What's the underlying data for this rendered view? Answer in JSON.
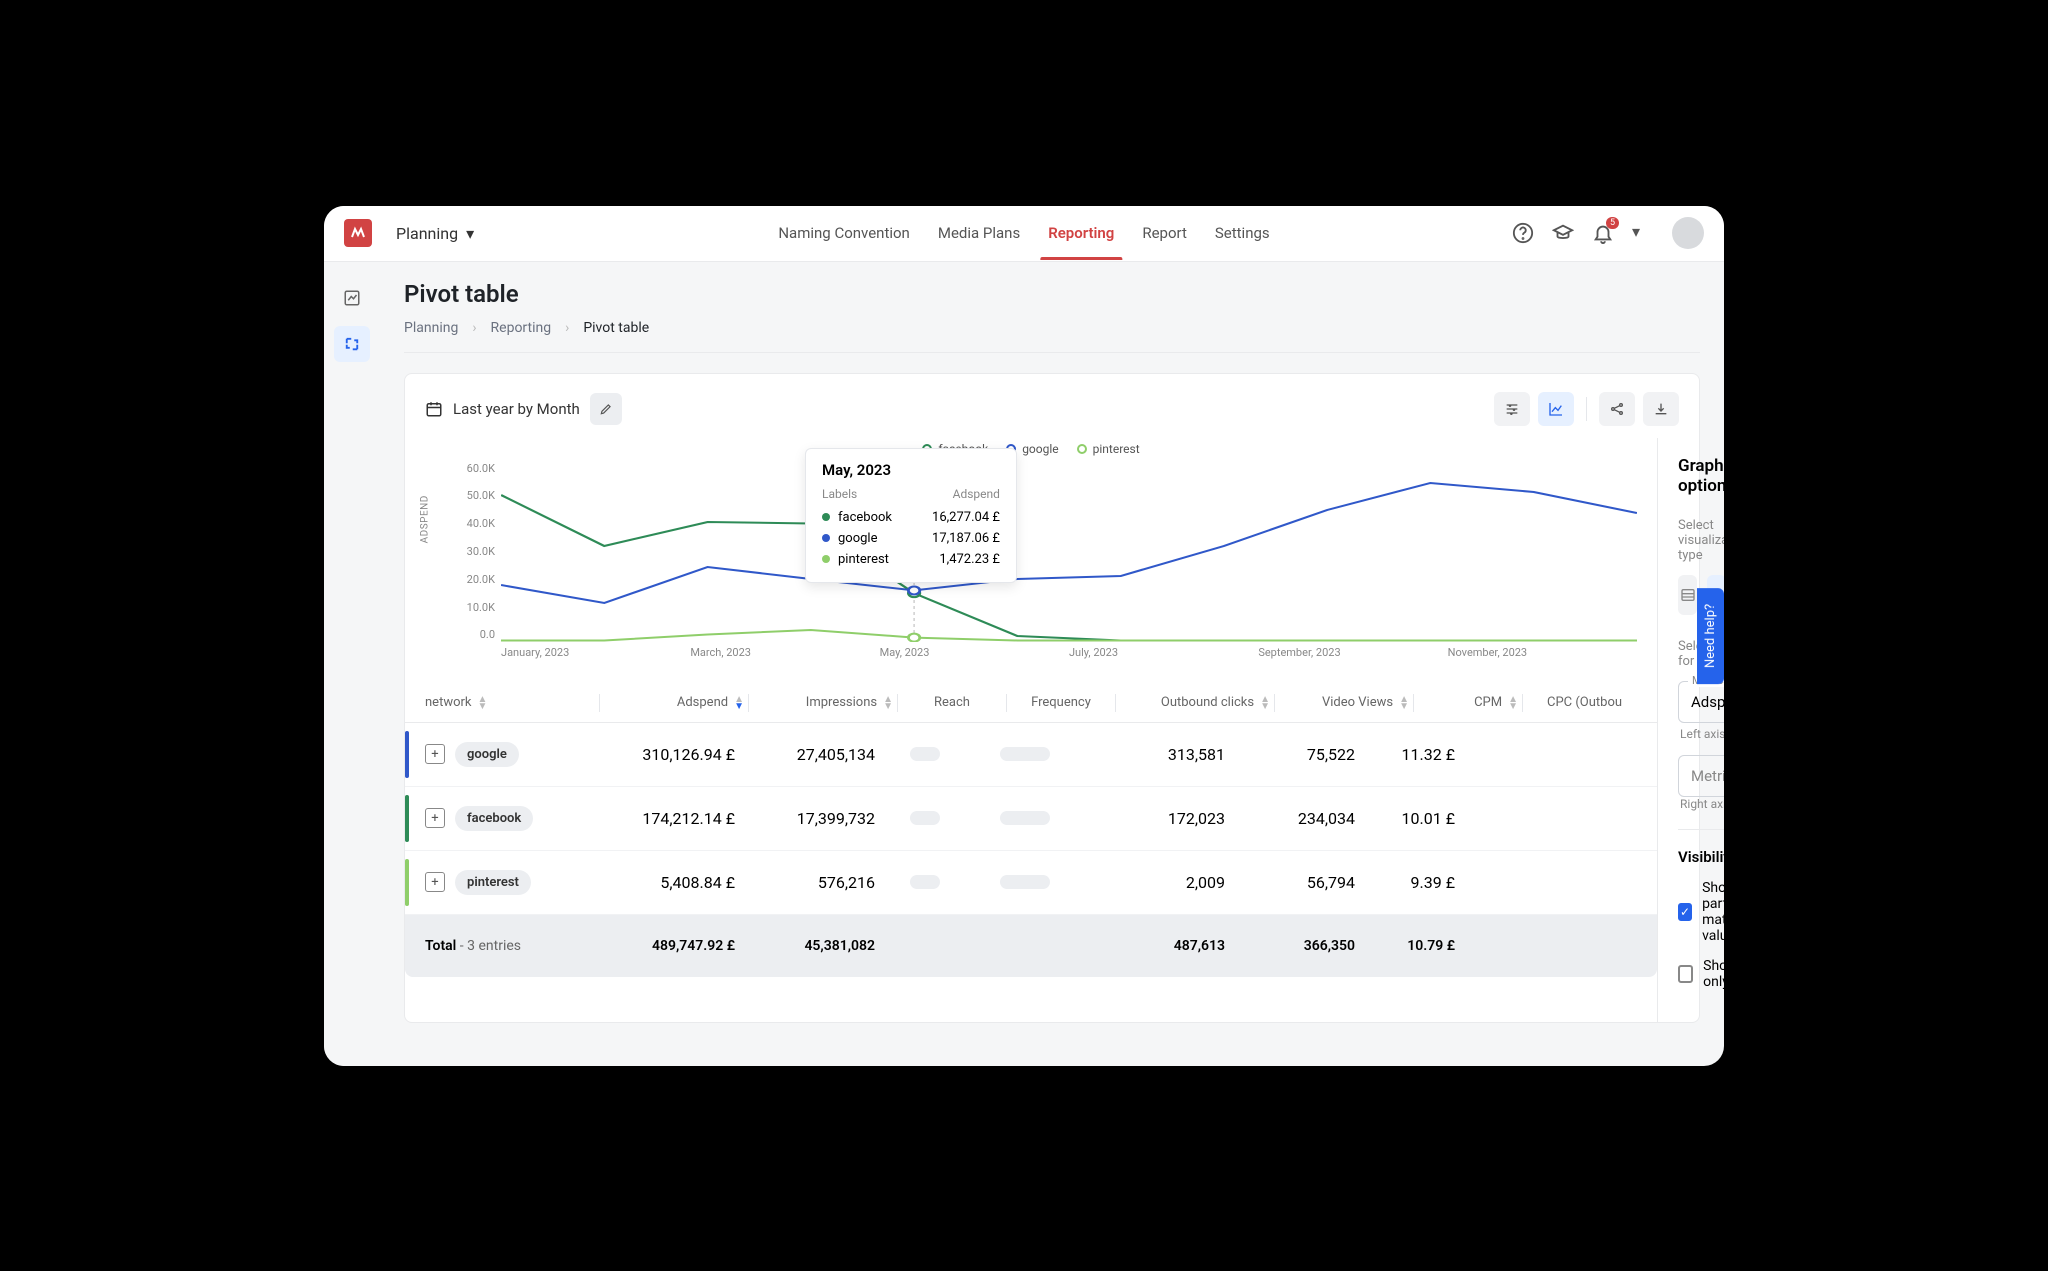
{
  "app_dropdown": "Planning",
  "top_tabs": [
    "Naming Convention",
    "Media Plans",
    "Reporting",
    "Report",
    "Settings"
  ],
  "active_tab": "Reporting",
  "notification_count": "5",
  "page_title": "Pivot table",
  "breadcrumb": [
    "Planning",
    "Reporting",
    "Pivot table"
  ],
  "date_range": "Last year by Month",
  "legend": [
    {
      "name": "facebook",
      "color": "#2e8b57"
    },
    {
      "name": "google",
      "color": "#3058c9"
    },
    {
      "name": "pinterest",
      "color": "#8fce6a"
    }
  ],
  "tooltip": {
    "title": "May, 2023",
    "head_left": "Labels",
    "head_right": "Adspend",
    "rows": [
      {
        "label": "facebook",
        "value": "16,277.04 £",
        "color": "#2e8b57"
      },
      {
        "label": "google",
        "value": "17,187.06 £",
        "color": "#3058c9"
      },
      {
        "label": "pinterest",
        "value": "1,472.23 £",
        "color": "#8fce6a"
      }
    ]
  },
  "chart_data": {
    "type": "line",
    "ylabel": "ADSPEND",
    "ylim": [
      0,
      60000
    ],
    "y_ticks": [
      "60.0K",
      "50.0K",
      "40.0K",
      "30.0K",
      "20.0K",
      "10.0K",
      "0.0"
    ],
    "x_ticks": [
      "January, 2023",
      "March, 2023",
      "May, 2023",
      "July, 2023",
      "September, 2023",
      "November, 2023"
    ],
    "categories": [
      "Jan 2023",
      "Feb 2023",
      "Mar 2023",
      "Apr 2023",
      "May 2023",
      "Jun 2023",
      "Jul 2023",
      "Aug 2023",
      "Sep 2023",
      "Oct 2023",
      "Nov 2023",
      "Dec 2023"
    ],
    "series": [
      {
        "name": "facebook",
        "color": "#2e8b57",
        "values": [
          49000,
          32000,
          40000,
          39500,
          16277,
          2000,
          500,
          500,
          500,
          500,
          500,
          500
        ]
      },
      {
        "name": "google",
        "color": "#3058c9",
        "values": [
          19000,
          13000,
          25000,
          21000,
          17187,
          21000,
          22000,
          32000,
          44000,
          53000,
          50000,
          43000
        ]
      },
      {
        "name": "pinterest",
        "color": "#8fce6a",
        "values": [
          500,
          500,
          2500,
          4000,
          1472,
          500,
          500,
          500,
          500,
          500,
          500,
          500
        ]
      }
    ]
  },
  "graph_options": {
    "title": "Graph options",
    "viz_label": "Select visualization type",
    "metrics_label": "Select metrics for the axes*",
    "left_metric_label": "Metrics*",
    "left_metric_value": "Adspend",
    "left_caption": "Left axis",
    "right_metric_placeholder": "Metrics*",
    "right_caption": "Right axis",
    "visibility_title": "Visibility",
    "check_partial": "Show partially matched values",
    "check_totals": "Show totals only"
  },
  "table": {
    "headers": [
      "network",
      "Adspend",
      "Impressions",
      "Reach",
      "Frequency",
      "Outbound clicks",
      "Video Views",
      "CPM",
      "CPC (Outbou"
    ],
    "rows": [
      {
        "network": "google",
        "color": "#3058c9",
        "adspend": "310,126.94 £",
        "impressions": "27,405,134",
        "outbound": "313,581",
        "video": "75,522",
        "cpm": "11.32 £"
      },
      {
        "network": "facebook",
        "color": "#2e8b57",
        "adspend": "174,212.14 £",
        "impressions": "17,399,732",
        "outbound": "172,023",
        "video": "234,034",
        "cpm": "10.01 £"
      },
      {
        "network": "pinterest",
        "color": "#8fce6a",
        "adspend": "5,408.84 £",
        "impressions": "576,216",
        "outbound": "2,009",
        "video": "56,794",
        "cpm": "9.39 £"
      }
    ],
    "total": {
      "label": "Total",
      "sub": " - 3 entries",
      "adspend": "489,747.92 £",
      "impressions": "45,381,082",
      "outbound": "487,613",
      "video": "366,350",
      "cpm": "10.79 £"
    }
  },
  "help_tab": "Need help?"
}
